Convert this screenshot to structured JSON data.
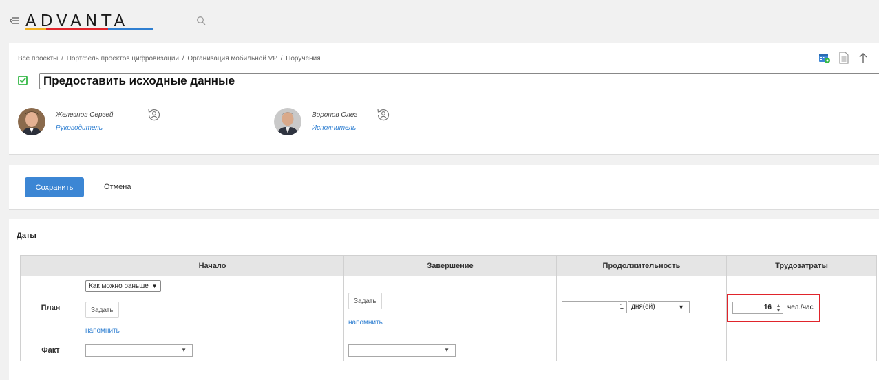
{
  "app": {
    "logo": "ADVANTA"
  },
  "breadcrumb": [
    "Все проекты",
    "Портфель проектов цифровизации",
    "Организация мобильной VP",
    "Поручения"
  ],
  "breadcrumb_sep": "/",
  "task": {
    "title": "Предоставить исходные данные"
  },
  "people": [
    {
      "name": "Железнов Сергей",
      "role": "Руководитель"
    },
    {
      "name": "Воронов Олег",
      "role": "Исполнитель"
    }
  ],
  "actions": {
    "save_label": "Сохранить",
    "cancel_label": "Отмена"
  },
  "dates": {
    "section_title": "Даты",
    "headers": [
      "Начало",
      "Завершение",
      "Продолжительность",
      "Трудозатраты"
    ],
    "rows": {
      "plan_label": "План",
      "fact_label": "Факт"
    },
    "plan": {
      "start_mode": "Как можно раньше",
      "set_label": "Задать",
      "remind_label": "напомнить",
      "duration_value": "1",
      "duration_unit": "дня(ей)",
      "effort_value": "16",
      "effort_unit": "чел./час"
    }
  },
  "colors": {
    "accent": "#3c86d4",
    "link": "#2f7fd1",
    "highlight": "#e0242b",
    "check": "#35b847"
  }
}
